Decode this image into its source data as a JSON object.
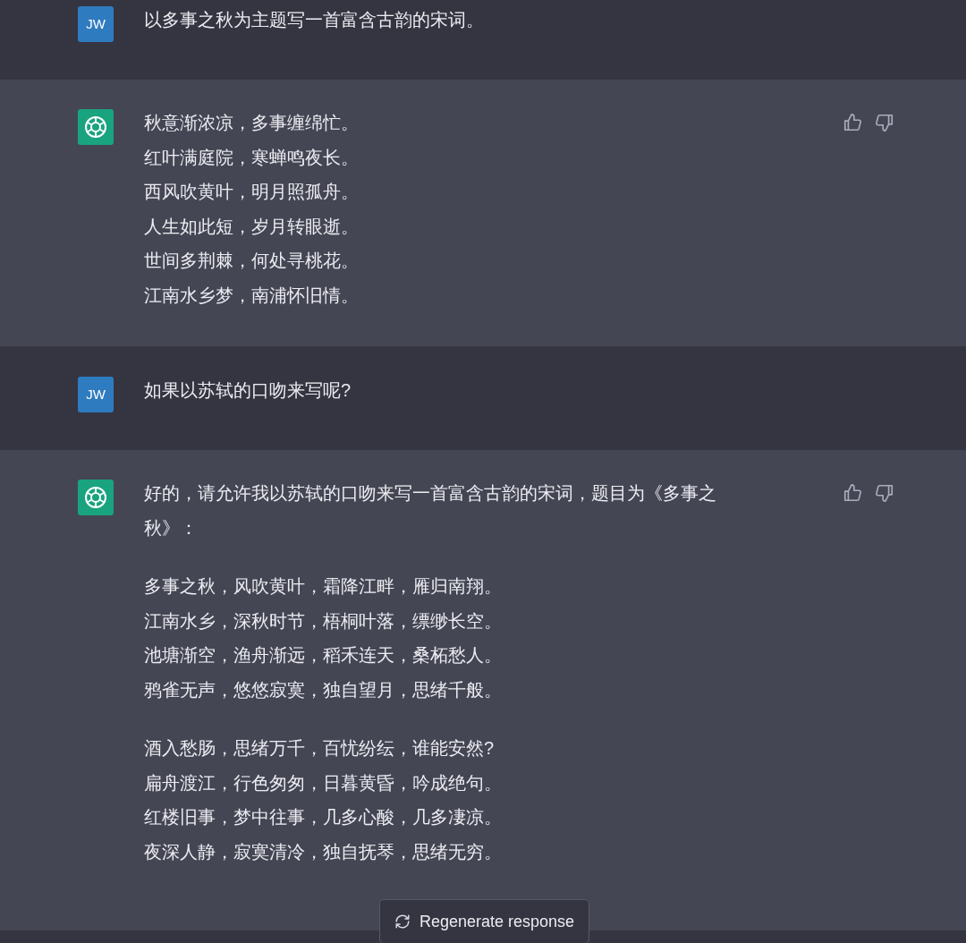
{
  "messages": [
    {
      "kind": "user",
      "avatar": "JW",
      "paragraphs": [
        [
          "以多事之秋为主题写一首富含古韵的宋词。"
        ]
      ]
    },
    {
      "kind": "assistant",
      "paragraphs": [
        [
          "秋意渐浓凉，多事缠绵忙。",
          "红叶满庭院，寒蝉鸣夜长。",
          "西风吹黄叶，明月照孤舟。",
          "人生如此短，岁月转眼逝。",
          "世间多荆棘，何处寻桃花。",
          "江南水乡梦，南浦怀旧情。"
        ]
      ]
    },
    {
      "kind": "user",
      "avatar": "JW",
      "paragraphs": [
        [
          "如果以苏轼的口吻来写呢?"
        ]
      ]
    },
    {
      "kind": "assistant",
      "paragraphs": [
        [
          "好的，请允许我以苏轼的口吻来写一首富含古韵的宋词，题目为《多事之秋》："
        ],
        [
          "多事之秋，风吹黄叶，霜降江畔，雁归南翔。",
          "江南水乡，深秋时节，梧桐叶落，缥缈长空。",
          "池塘渐空，渔舟渐远，稻禾连天，桑柘愁人。",
          "鸦雀无声，悠悠寂寞，独自望月，思绪千般。"
        ],
        [
          "酒入愁肠，思绪万千，百忧纷纭，谁能安然?",
          "扁舟渡江，行色匆匆，日暮黄昏，吟成绝句。",
          "红楼旧事，梦中往事，几多心酸，几多凄凉。",
          "夜深人静，寂寞清冷，独自抚琴，思绪无穷。"
        ]
      ]
    }
  ],
  "regenerate_button": {
    "label": "Regenerate response"
  }
}
